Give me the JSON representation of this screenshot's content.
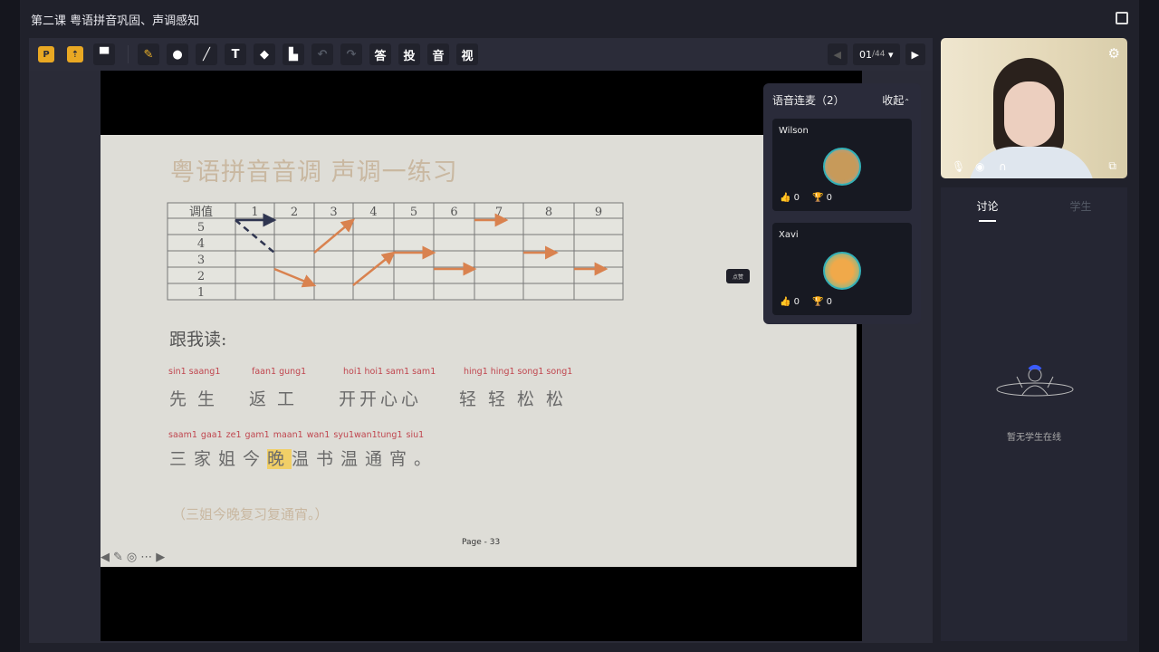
{
  "window": {
    "title": "第二课 粤语拼音巩固、声调感知"
  },
  "toolbar": {
    "tools": [
      {
        "name": "ppt-icon",
        "label": "P",
        "accent": true
      },
      {
        "name": "upload-screen-icon",
        "label": "⇡",
        "accent": true
      },
      {
        "name": "blackboard-icon",
        "label": "▀"
      },
      {
        "name": "brush-icon",
        "label": "✎",
        "accent": true
      },
      {
        "name": "laser-pointer-icon",
        "label": "●"
      },
      {
        "name": "line-icon",
        "label": "╱"
      },
      {
        "name": "text-icon",
        "label": "T"
      },
      {
        "name": "eraser-icon",
        "label": "◆"
      },
      {
        "name": "clear-brush-icon",
        "label": "▙"
      },
      {
        "name": "undo-icon",
        "label": "↶",
        "disabled": true
      },
      {
        "name": "redo-icon",
        "label": "↷",
        "disabled": true
      },
      {
        "name": "answer-icon",
        "label": "答"
      },
      {
        "name": "vote-icon",
        "label": "投"
      },
      {
        "name": "audio-icon",
        "label": "音"
      },
      {
        "name": "video-icon",
        "label": "视"
      }
    ],
    "page_current": "01",
    "page_total": "/44"
  },
  "slide": {
    "title": "粤语拼音音调 声调一练习",
    "table": {
      "header": "调值",
      "columns": [
        "1",
        "2",
        "3",
        "4",
        "5",
        "6",
        "7",
        "8",
        "9"
      ],
      "levels": [
        "5",
        "4",
        "3",
        "2",
        "1"
      ],
      "contours": [
        {
          "col": 1,
          "from": 5,
          "to": 5,
          "color": "#2f3550",
          "dashed": false
        },
        {
          "col": 1,
          "from": 5,
          "to": 3,
          "color": "#2f3550",
          "dashed": true,
          "noarrow": true
        },
        {
          "col": 2,
          "from": 2,
          "to": 1,
          "color": "#d9824f"
        },
        {
          "col": 3,
          "from": 3,
          "to": 5,
          "color": "#d9824f"
        },
        {
          "col": 4,
          "from": 1,
          "to": 3,
          "color": "#d9824f"
        },
        {
          "col": 5,
          "from": 3,
          "to": 3,
          "color": "#d9824f"
        },
        {
          "col": 6,
          "from": 2,
          "to": 2,
          "color": "#d9824f"
        },
        {
          "col": 7,
          "from": 5,
          "to": 5,
          "color": "#d9824f",
          "short": true
        },
        {
          "col": 8,
          "from": 3,
          "to": 3,
          "color": "#d9824f",
          "short": true
        },
        {
          "col": 9,
          "from": 2,
          "to": 2,
          "color": "#d9824f",
          "short": true
        }
      ]
    },
    "follow_label": "跟我读:",
    "line1": [
      {
        "py": "sin1   saang1",
        "hz": "先生"
      },
      {
        "py": "faan1  gung1",
        "hz": "返工"
      },
      {
        "py": "hoi1   hoi1    sam1   sam1",
        "hz": "开开心心"
      },
      {
        "py": "hing1   hing1   song1   song1",
        "hz": "轻轻松松"
      }
    ],
    "line2_py": "saam1 gaa1 ze1  gam1  maan1 wan1 syu1wan1tung1 siu1",
    "line2_before": "三家姐今",
    "line2_highlight": "晚",
    "line2_after": "温书温通宵。",
    "translation": "（三姐今晚复习复通宵。）",
    "page_label": "Page - 33",
    "controls": [
      "◀",
      "✎",
      "◎",
      "⋯",
      "▶"
    ],
    "like_badge": "点赞"
  },
  "voice_panel": {
    "title": "语音连麦（2）",
    "collapse": "收起",
    "members": [
      {
        "name": "Wilson",
        "likes": "0",
        "trophies": "0",
        "avatar_color": "#c79a5a"
      },
      {
        "name": "Xavi",
        "likes": "0",
        "trophies": "0",
        "avatar_color": "#f0a94a"
      }
    ]
  },
  "sidebar": {
    "tabs": [
      {
        "label": "讨论",
        "active": true
      },
      {
        "label": "学生",
        "active": false
      }
    ],
    "empty_text": "暂无学生在线"
  }
}
